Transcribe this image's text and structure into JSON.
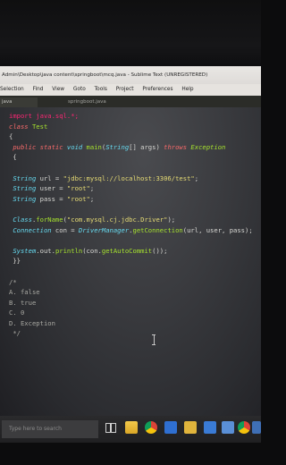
{
  "window": {
    "title": "Admin\\Desktop\\java content\\springboot\\mcq.java - Sublime Text (UNREGISTERED)"
  },
  "menu": [
    "Selection",
    "Find",
    "View",
    "Goto",
    "Tools",
    "Project",
    "Preferences",
    "Help"
  ],
  "tabs": [
    {
      "label": "java",
      "active": true
    },
    {
      "label": "springboot.java",
      "active": false
    }
  ],
  "code": {
    "l1": "import java.sql.*;",
    "l2_kw": "class",
    "l2_name": " Test",
    "l3": "{",
    "l4_public": " public",
    "l4_static": " static",
    "l4_void": " void",
    "l4_main": " main",
    "l4_open": "(",
    "l4_type": "String",
    "l4_args": "[] args) ",
    "l4_throws": "throws",
    "l4_exc": " Exception",
    "l5": " {",
    "url_type": "String",
    "url_rest": " url = ",
    "url_val": "\"jdbc:mysql://localhost:3306/test\"",
    "url_end": ";",
    "user_type": "String",
    "user_rest": " user = ",
    "user_val": "\"root\"",
    "user_end": ";",
    "pass_type": "String",
    "pass_rest": " pass = ",
    "pass_val": "\"root\"",
    "pass_end": ";",
    "forname_cls": "Class",
    "forname_dot": ".",
    "forname_fn": "forName",
    "forname_open": "(",
    "forname_val": "\"com.mysql.cj.jdbc.Driver\"",
    "forname_end": ");",
    "conn_type": "Connection",
    "conn_rest": " con = ",
    "conn_dm": "DriverManager",
    "conn_dot": ".",
    "conn_fn": "getConnection",
    "conn_args": "(url, user, pass);",
    "print_sys": "System",
    "print_mid": ".out.",
    "print_fn": "println",
    "print_args": "(con.",
    "print_fn2": "getAutoCommit",
    "print_end": "());",
    "close1": " }}",
    "cmt_open": "/*",
    "opt_a": "A. false",
    "opt_b": "B. true",
    "opt_c": "C. 0",
    "opt_d": "D. Exception",
    "cmt_close": " */"
  },
  "taskbar": {
    "search_placeholder": "Type here to search",
    "icons": [
      "task-view-icon",
      "file-explorer-icon",
      "chrome-icon",
      "edge-icon",
      "folder-icon",
      "store-icon",
      "mail-icon",
      "chrome-icon",
      "app-icon"
    ]
  },
  "colors": {
    "keyword": "#f76a6a",
    "type": "#66d9ef",
    "string": "#e6db74",
    "function": "#a6e22e",
    "editor_bg": "#3a3b3f"
  }
}
